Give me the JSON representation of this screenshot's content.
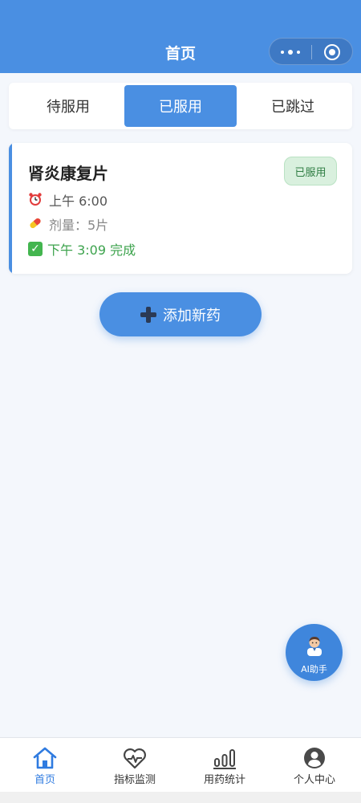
{
  "header": {
    "title": "首页"
  },
  "tabs": [
    {
      "label": "待服用",
      "active": false
    },
    {
      "label": "已服用",
      "active": true
    },
    {
      "label": "已跳过",
      "active": false
    }
  ],
  "card": {
    "name": "肾炎康复片",
    "status_badge": "已服用",
    "time_icon": "alarm-clock-icon",
    "time": "上午 6:00",
    "dose_icon": "pill-icon",
    "dose": "剂量：5片",
    "done_icon": "check-mark-icon",
    "done": "下午 3:09 完成"
  },
  "add_button": {
    "label": "添加新药"
  },
  "ai_button": {
    "label": "AI助手"
  },
  "tabbar": [
    {
      "label": "首页",
      "icon": "home-icon",
      "active": true
    },
    {
      "label": "指标监测",
      "icon": "heart-pulse-icon",
      "active": false
    },
    {
      "label": "用药统计",
      "icon": "bar-stats-icon",
      "active": false
    },
    {
      "label": "个人中心",
      "icon": "user-avatar-icon",
      "active": false
    }
  ],
  "colors": {
    "primary": "#4a8fe2",
    "background": "#f4f7fc",
    "success_text": "#3da34d",
    "badge_bg": "#d9f0de"
  }
}
